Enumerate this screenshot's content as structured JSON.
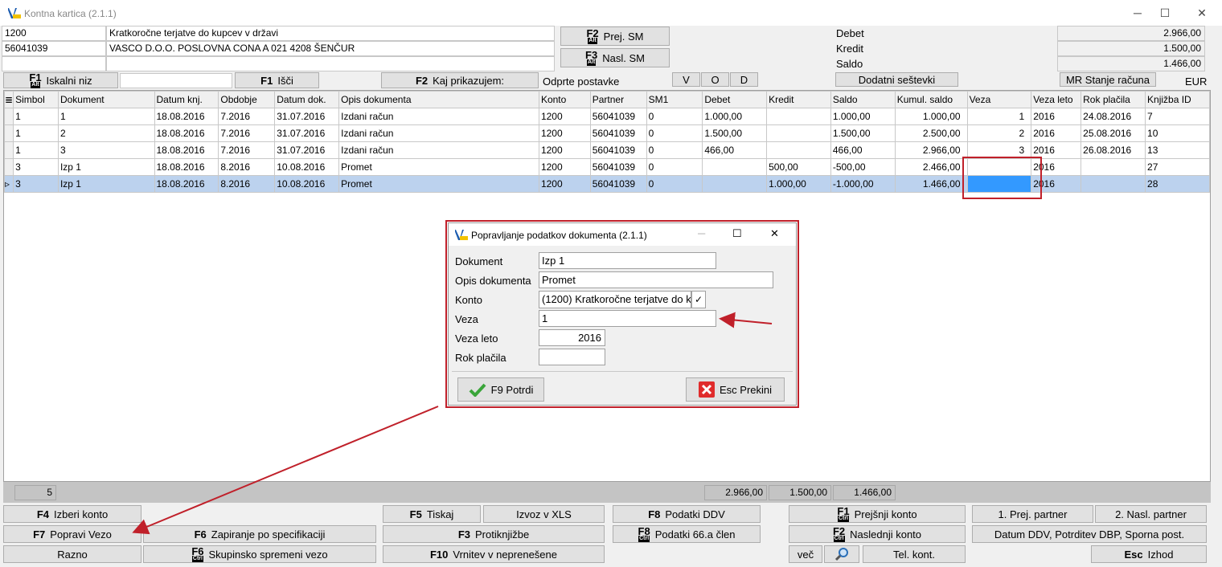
{
  "window": {
    "title": "Kontna kartica  (2.1.1)",
    "min": "─",
    "max": "☐",
    "close": "✕"
  },
  "header": {
    "konto": "1200",
    "konto_name": "Kratkoročne terjatve do kupcev v državi",
    "partner": "56041039",
    "partner_name": "VASCO D.O.O.  POSLOVNA CONA A 021 4208 ŠENČUR",
    "prej_sm": {
      "key": "F2",
      "mod": "Alt",
      "label": "Prej. SM"
    },
    "nasl_sm": {
      "key": "F3",
      "mod": "Alt",
      "label": "Nasl. SM"
    },
    "debet_label": "Debet",
    "kredit_label": "Kredit",
    "saldo_label": "Saldo",
    "debet": "2.966,00",
    "kredit": "1.500,00",
    "saldo": "1.466,00"
  },
  "toolbar": {
    "iskalni": {
      "key": "F1",
      "mod": "Alt",
      "label": "Iskalni niz"
    },
    "search_value": "",
    "isci": {
      "key": "F1",
      "label": "Išči"
    },
    "kaj": {
      "key": "F2",
      "label": "Kaj prikazujem:"
    },
    "mode": "Odprte postavke",
    "v": "V",
    "o": "O",
    "d": "D",
    "dodatni": "Dodatni seštevki",
    "mr": "MR Stanje računa",
    "currency": "EUR"
  },
  "grid": {
    "columns": [
      "Simbol",
      "Dokument",
      "Datum knj.",
      "Obdobje",
      "Datum dok.",
      "Opis dokumenta",
      "Konto",
      "Partner",
      "SM1",
      "Debet",
      "Kredit",
      "Saldo",
      "Kumul. saldo",
      "Veza",
      "Veza leto",
      "Rok plačila",
      "Knjižba ID"
    ],
    "rows": [
      [
        "1",
        "1",
        "18.08.2016",
        "7.2016",
        "31.07.2016",
        "Izdani račun",
        "1200",
        "56041039",
        "0",
        "1.000,00",
        "",
        "1.000,00",
        "1.000,00",
        "1",
        "2016",
        "24.08.2016",
        "7"
      ],
      [
        "1",
        "2",
        "18.08.2016",
        "7.2016",
        "31.07.2016",
        "Izdani račun",
        "1200",
        "56041039",
        "0",
        "1.500,00",
        "",
        "1.500,00",
        "2.500,00",
        "2",
        "2016",
        "25.08.2016",
        "10"
      ],
      [
        "1",
        "3",
        "18.08.2016",
        "7.2016",
        "31.07.2016",
        "Izdani račun",
        "1200",
        "56041039",
        "0",
        "466,00",
        "",
        "466,00",
        "2.966,00",
        "3",
        "2016",
        "26.08.2016",
        "13"
      ],
      [
        "3",
        "Izp 1",
        "18.08.2016",
        "8.2016",
        "10.08.2016",
        "Promet",
        "1200",
        "56041039",
        "0",
        "",
        "500,00",
        "-500,00",
        "2.466,00",
        "",
        "2016",
        "",
        "27"
      ],
      [
        "3",
        "Izp 1",
        "18.08.2016",
        "8.2016",
        "10.08.2016",
        "Promet",
        "1200",
        "56041039",
        "0",
        "",
        "1.000,00",
        "-1.000,00",
        "1.466,00",
        "",
        "2016",
        "",
        "28"
      ]
    ],
    "row_marker": "▹"
  },
  "totals": {
    "count": "5",
    "debet": "2.966,00",
    "kredit": "1.500,00",
    "saldo": "1.466,00"
  },
  "dialog": {
    "title": "Popravljanje podatkov dokumenta  (2.1.1)",
    "dokument_label": "Dokument",
    "dokument": "Izp 1",
    "opis_label": "Opis dokumenta",
    "opis": "Promet",
    "konto_label": "Konto",
    "konto": "(1200) Kratkoročne terjatve do k",
    "veza_label": "Veza",
    "veza": "1",
    "veza_leto_label": "Veza leto",
    "veza_leto": "2016",
    "rok_label": "Rok plačila",
    "rok": "",
    "ok": "F9 Potrdi",
    "cancel": "Esc Prekini"
  },
  "buttons": {
    "izberi": {
      "key": "F4",
      "label": "Izberi konto"
    },
    "popravi": {
      "key": "F7",
      "label": "Popravi Vezo"
    },
    "razno": "Razno",
    "zapiranje": {
      "key": "F6",
      "label": "Zapiranje po specifikaciji"
    },
    "skupinsko": {
      "key": "F6",
      "mod": "Ctrl",
      "label": "Skupinsko spremeni vezo"
    },
    "tiskaj": {
      "key": "F5",
      "label": "Tiskaj"
    },
    "izvoz": "Izvoz v XLS",
    "protik": {
      "key": "F3",
      "label": "Protiknjižbe"
    },
    "vrnitev": {
      "key": "F10",
      "label": "Vrnitev v neprenešene"
    },
    "ddv": {
      "key": "F8",
      "label": "Podatki DDV"
    },
    "p66": {
      "key": "F8",
      "mod": "Ctrl",
      "label": "Podatki 66.a člen"
    },
    "prejsnji": {
      "key": "F1",
      "mod": "Ctrl",
      "label": "Prejšnji konto"
    },
    "naslednji": {
      "key": "F2",
      "mod": "Ctrl",
      "label": "Naslednji konto"
    },
    "vec": "več",
    "tel": "Tel. kont.",
    "prej_partner": "1. Prej. partner",
    "nasl_partner": "2. Nasl. partner",
    "datum_ddv": "Datum DDV, Potrditev DBP, Sporna post.",
    "izhod": {
      "key": "Esc",
      "label": "Izhod"
    }
  }
}
